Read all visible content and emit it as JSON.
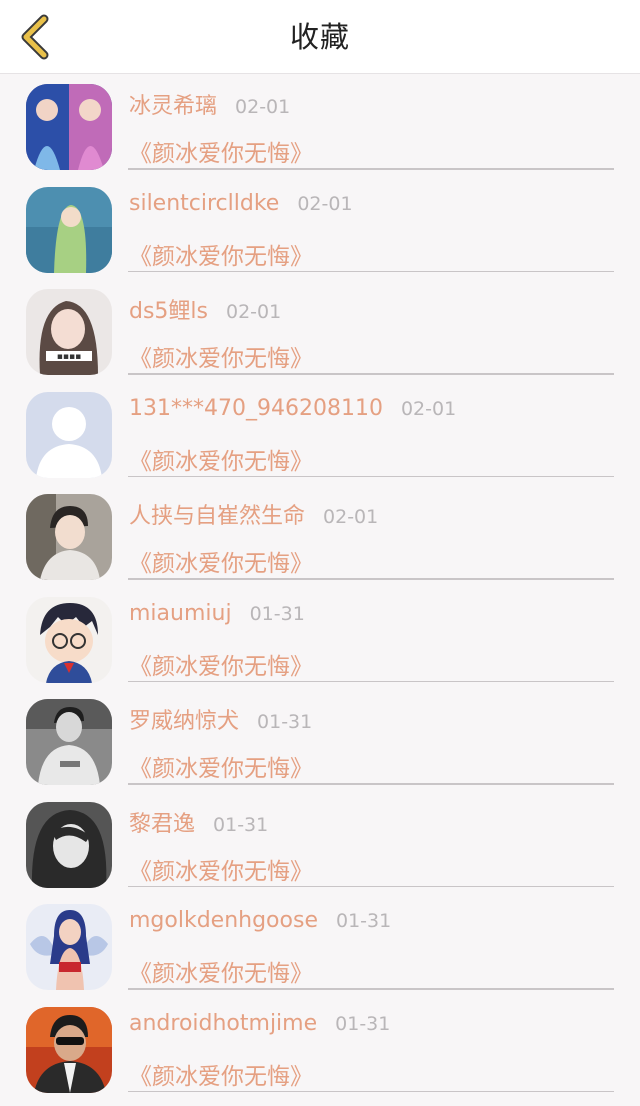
{
  "header": {
    "title": "收藏",
    "back_icon": "chevron-left-icon",
    "back_color": "#e9c14a"
  },
  "colors": {
    "accent": "#e5a082",
    "date": "#b9b6b8",
    "divider": "#c9c5c7"
  },
  "favorites": [
    {
      "user": "冰灵希璃",
      "date": "02-01",
      "title": "《颜冰爱你无悔》"
    },
    {
      "user": "silentcirclldke",
      "date": "02-01",
      "title": "《颜冰爱你无悔》"
    },
    {
      "user": "ds5鲤ls",
      "date": "02-01",
      "title": "《颜冰爱你无悔》"
    },
    {
      "user": "131***470_946208110",
      "date": "02-01",
      "title": "《颜冰爱你无悔》"
    },
    {
      "user": "人挟与自崔然生命",
      "date": "02-01",
      "title": "《颜冰爱你无悔》"
    },
    {
      "user": "miaumiuj",
      "date": "01-31",
      "title": "《颜冰爱你无悔》"
    },
    {
      "user": "罗威纳惊犬",
      "date": "01-31",
      "title": "《颜冰爱你无悔》"
    },
    {
      "user": "黎君逸",
      "date": "01-31",
      "title": "《颜冰爱你无悔》"
    },
    {
      "user": "mgolkdenhgoose",
      "date": "01-31",
      "title": "《颜冰爱你无悔》"
    },
    {
      "user": "androidhotmjime",
      "date": "01-31",
      "title": "《颜冰爱你无悔》"
    }
  ]
}
